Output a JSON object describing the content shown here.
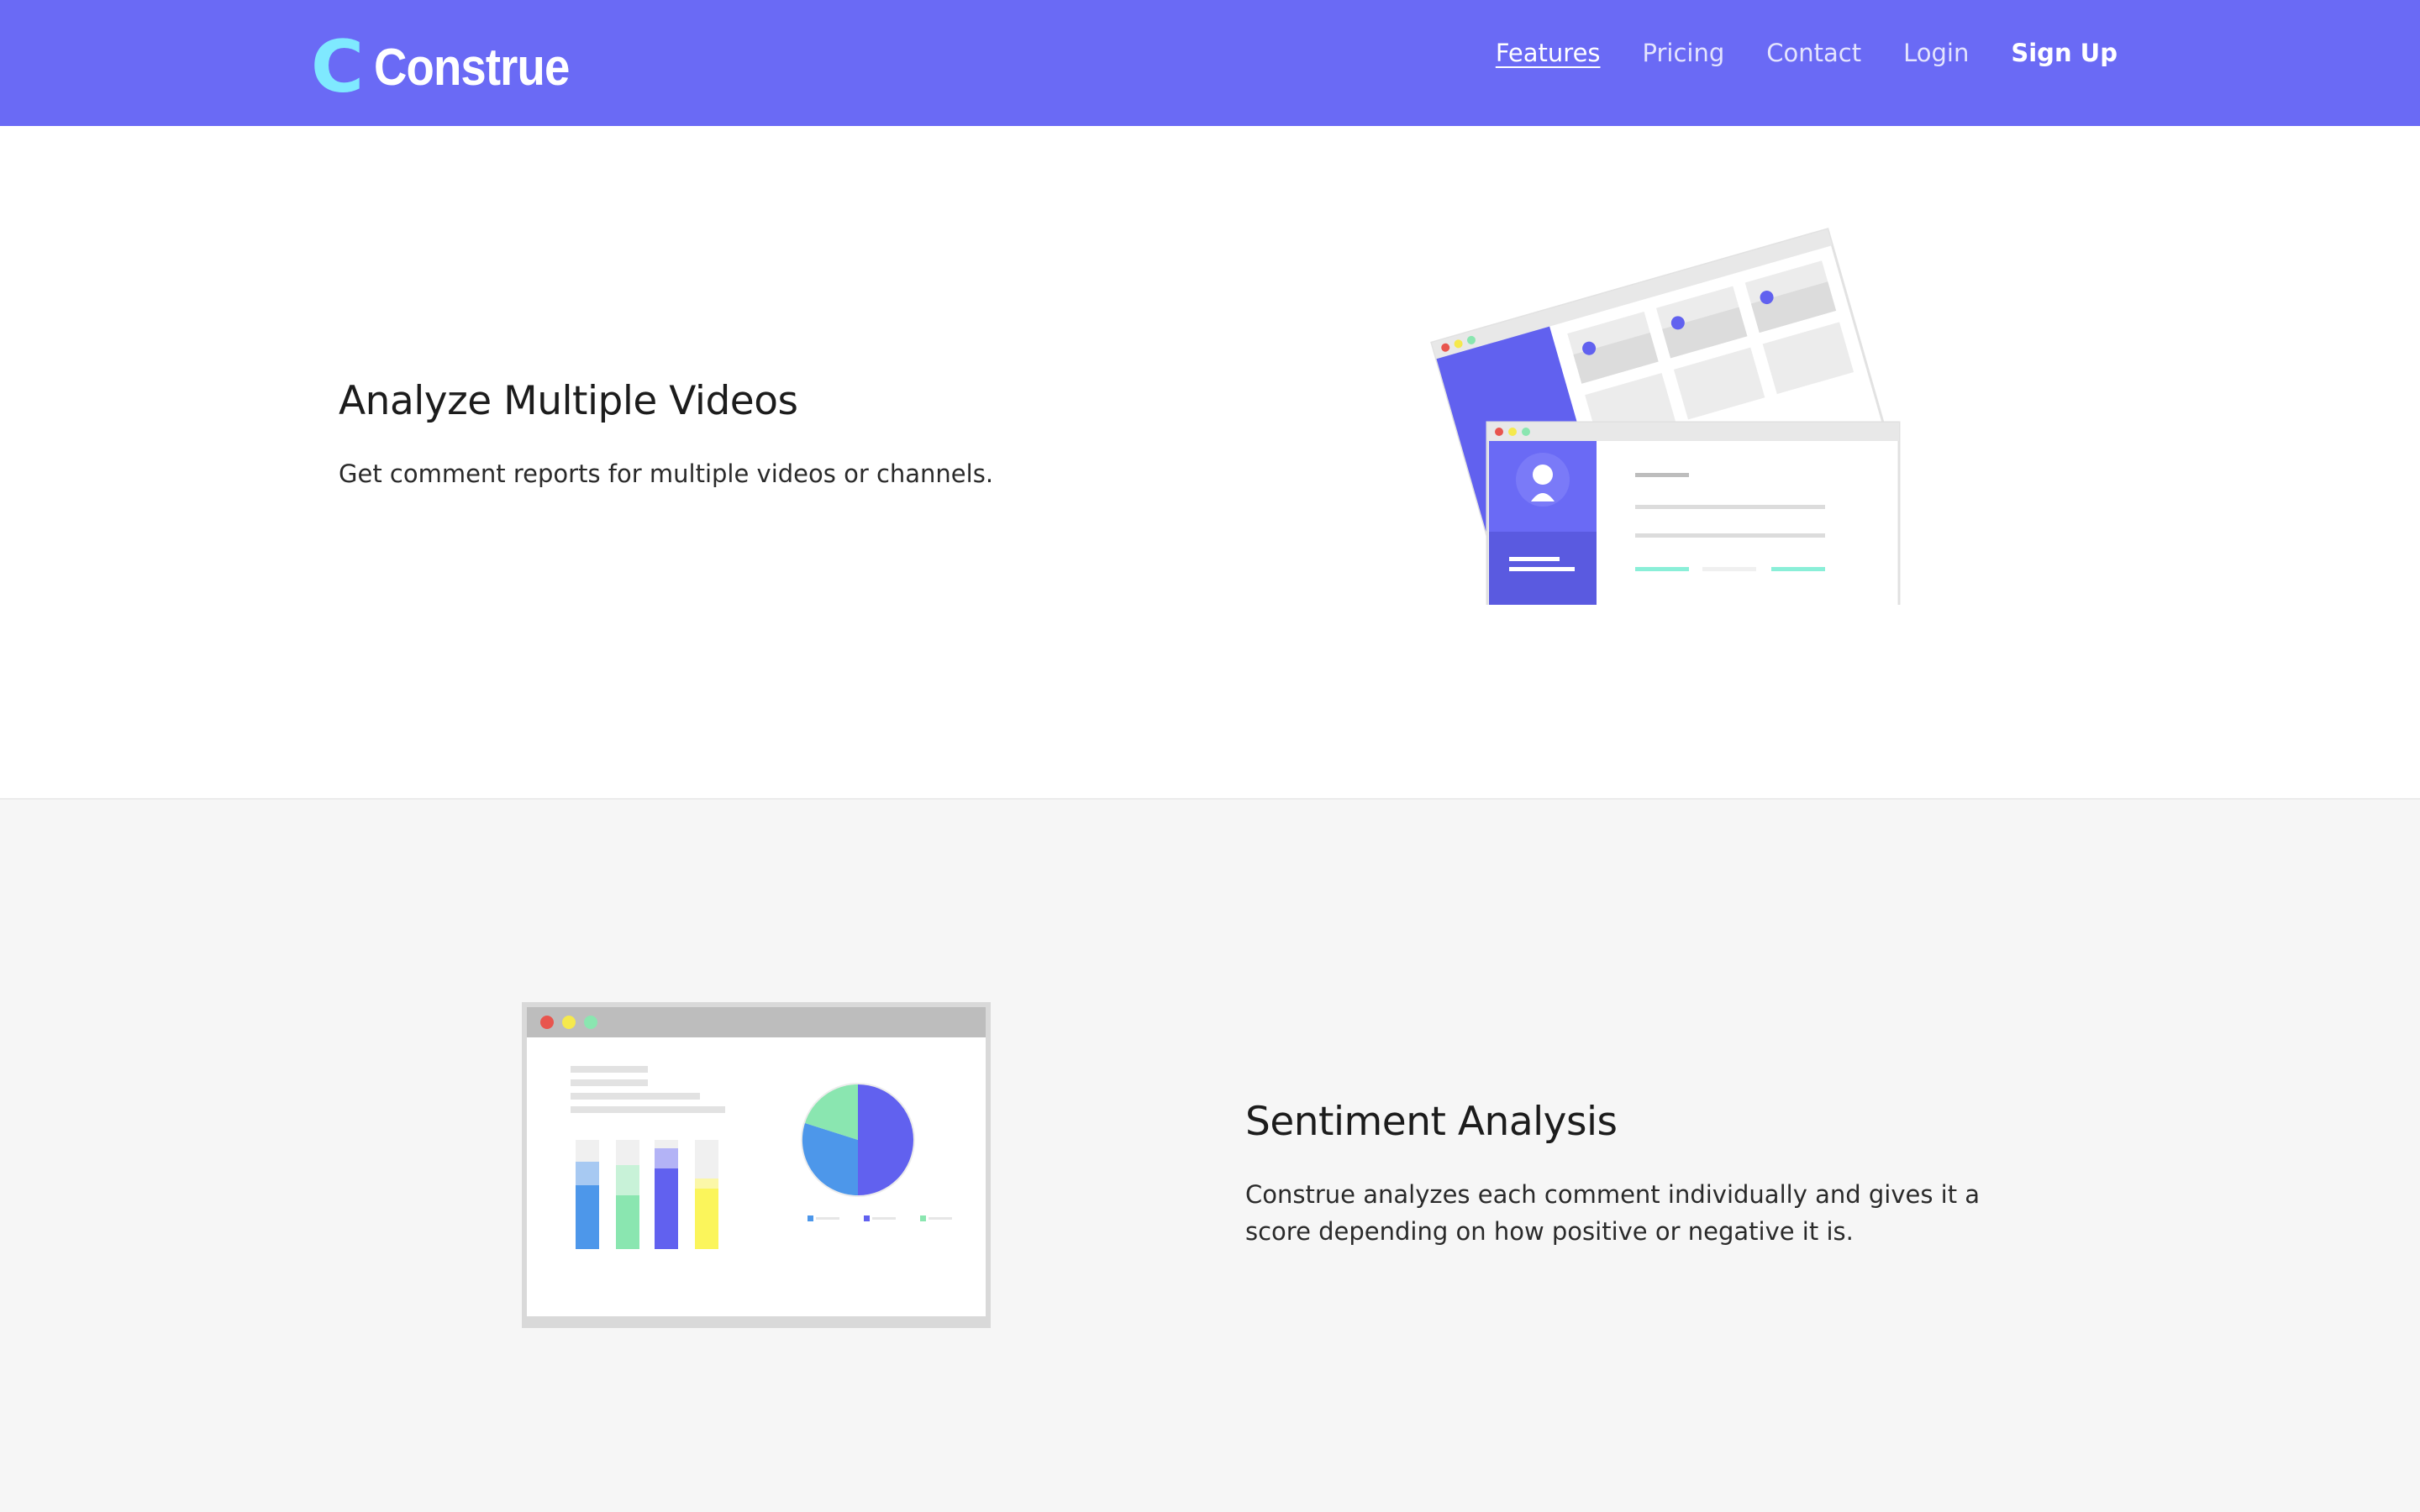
{
  "brand": {
    "logo_mark": "C",
    "name": "Construe"
  },
  "nav": {
    "items": [
      {
        "label": "Features",
        "active": true
      },
      {
        "label": "Pricing"
      },
      {
        "label": "Contact"
      },
      {
        "label": "Login"
      },
      {
        "label": "Sign Up",
        "emphasis": true
      }
    ]
  },
  "features": [
    {
      "title": "Analyze Multiple Videos",
      "description": "Get comment reports for multiple videos or channels.",
      "illustration_icon": "multiple-dashboards-illustration"
    },
    {
      "title": "Sentiment Analysis",
      "description": "Construe analyzes each comment individually and gives it a score depending on how positive or negative it is.",
      "illustration_icon": "analytics-dashboard-illustration"
    }
  ],
  "colors": {
    "nav_bg": "#6a6af5",
    "logo_mark": "#7fe9ff",
    "accent_purple": "#6161ef",
    "accent_blue": "#4d97ea",
    "accent_green": "#8ae6b0",
    "accent_yellow": "#fbf55b",
    "section_alt_bg": "#f6f6f6"
  }
}
